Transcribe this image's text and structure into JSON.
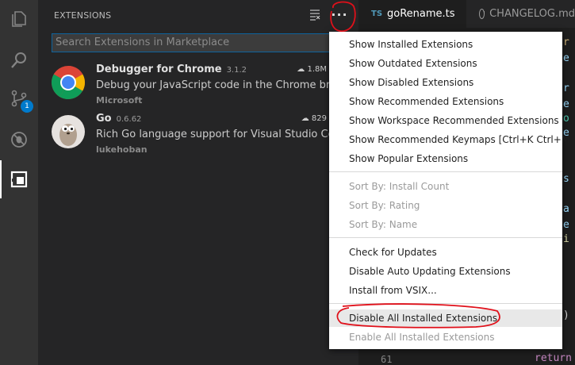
{
  "activity_bar": {
    "items": [
      {
        "icon": "explorer-icon"
      },
      {
        "icon": "search-icon"
      },
      {
        "icon": "source-control-icon",
        "badge": "1"
      },
      {
        "icon": "debug-icon"
      },
      {
        "icon": "extensions-icon"
      }
    ]
  },
  "sidebar": {
    "title": "EXTENSIONS",
    "search_placeholder": "Search Extensions in Marketplace",
    "extensions": [
      {
        "name": "Debugger for Chrome",
        "version": "3.1.2",
        "downloads": "1.8M",
        "description": "Debug your JavaScript code in the Chrome browser",
        "publisher": "Microsoft",
        "icon": "chrome-icon"
      },
      {
        "name": "Go",
        "version": "0.6.62",
        "downloads": "829",
        "description": "Rich Go language support for Visual Studio Code",
        "publisher": "lukehoban",
        "icon": "gopher-icon"
      }
    ]
  },
  "editor": {
    "tabs": [
      {
        "badge": "TS",
        "label": "goRename.ts",
        "active": true
      },
      {
        "label": "CHANGELOG.md",
        "active": false
      }
    ],
    "line_number": "61",
    "return_keyword": "return"
  },
  "menu": {
    "group1": [
      "Show Installed Extensions",
      "Show Outdated Extensions",
      "Show Disabled Extensions",
      "Show Recommended Extensions",
      "Show Workspace Recommended Extensions",
      "Show Recommended Keymaps [Ctrl+K Ctrl+M]",
      "Show Popular Extensions"
    ],
    "group2": [
      "Sort By: Install Count",
      "Sort By: Rating",
      "Sort By: Name"
    ],
    "group3": [
      "Check for Updates",
      "Disable Auto Updating Extensions",
      "Install from VSIX..."
    ],
    "group4": [
      "Disable All Installed Extensions",
      "Enable All Installed Extensions"
    ]
  },
  "colors": {
    "accent": "#007acc",
    "annotation_red": "#e0101a"
  }
}
